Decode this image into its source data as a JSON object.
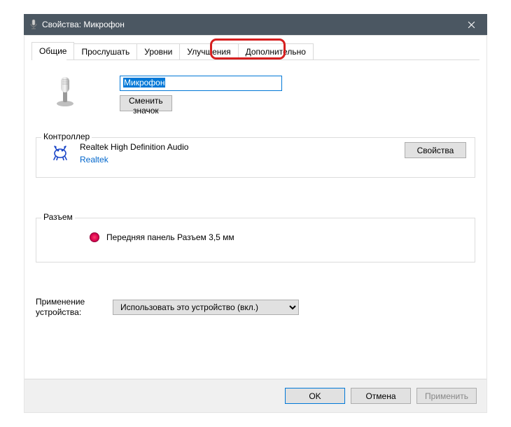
{
  "titlebar": {
    "title": "Свойства: Микрофон"
  },
  "tabs": {
    "general": "Общие",
    "listen": "Прослушать",
    "levels": "Уровни",
    "enhance": "Улучшения",
    "advanced": "Дополнительно"
  },
  "device": {
    "name_value": "Микрофон",
    "change_icon": "Сменить значок"
  },
  "controller": {
    "group_label": "Контроллер",
    "name": "Realtek High Definition Audio",
    "manufacturer": "Realtek",
    "properties_btn": "Свойства"
  },
  "jack": {
    "group_label": "Разъем",
    "desc": "Передняя панель Разъем 3,5 мм"
  },
  "usage": {
    "label": "Применение устройства:",
    "selected": "Использовать это устройство (вкл.)"
  },
  "buttons": {
    "ok": "OK",
    "cancel": "Отмена",
    "apply": "Применить"
  }
}
